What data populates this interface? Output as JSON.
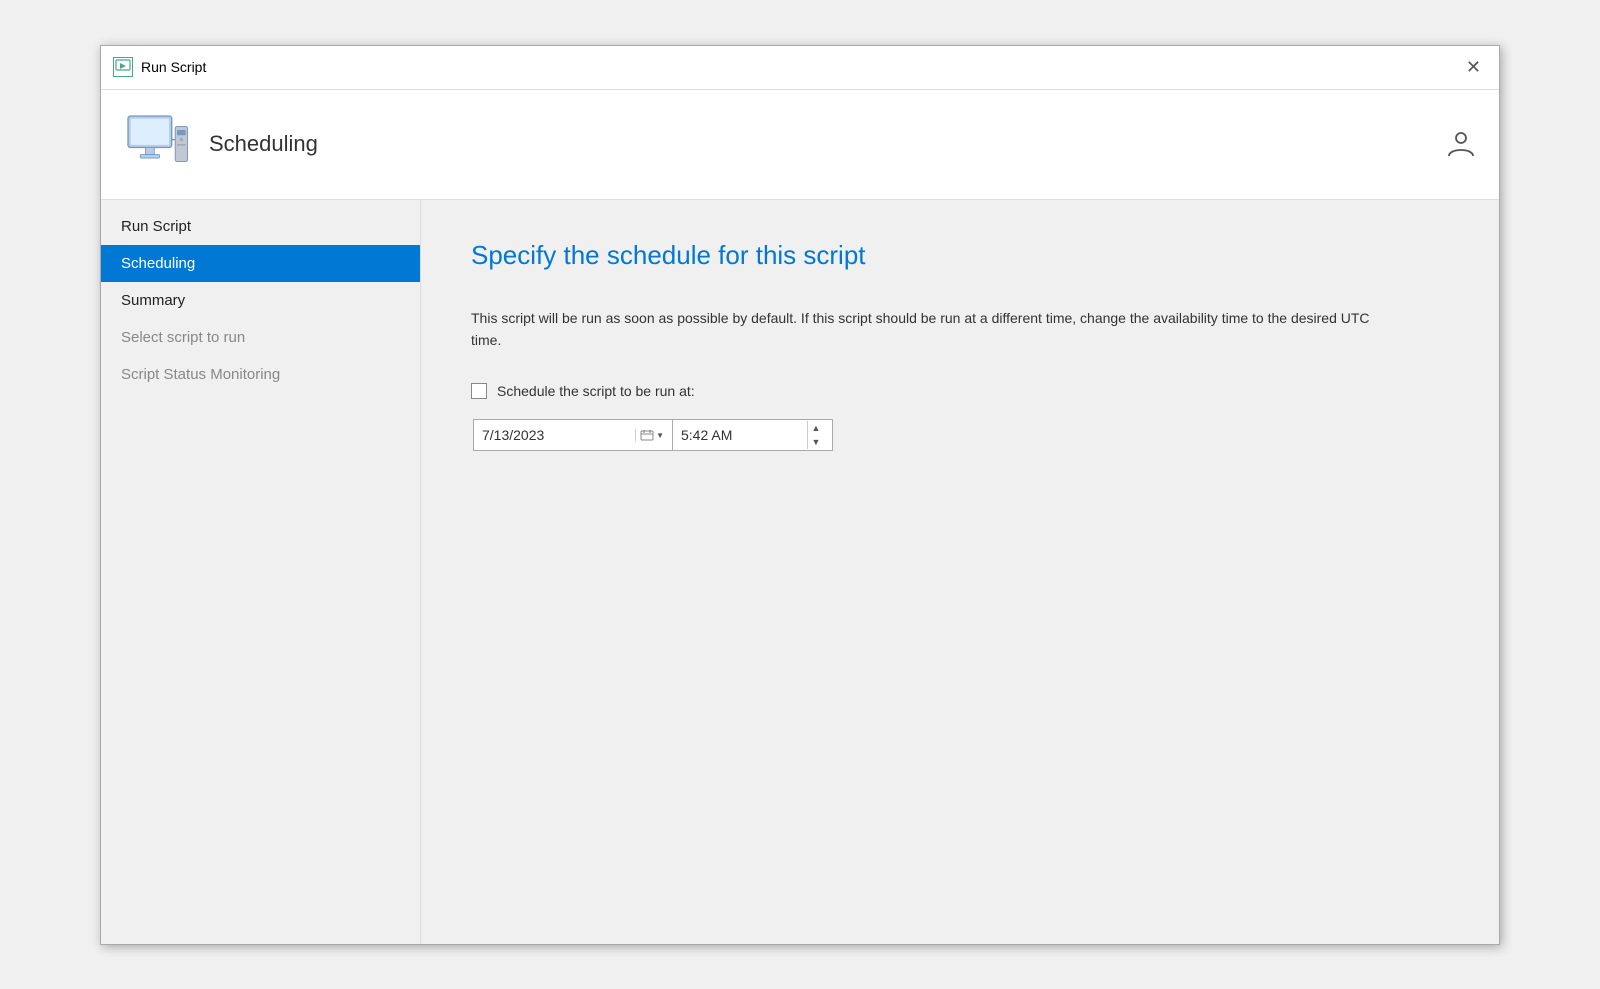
{
  "dialog": {
    "title": "Run Script",
    "close_label": "✕"
  },
  "header": {
    "title": "Scheduling",
    "help_icon": "?"
  },
  "sidebar": {
    "items": [
      {
        "id": "run-script",
        "label": "Run Script",
        "state": "normal"
      },
      {
        "id": "scheduling",
        "label": "Scheduling",
        "state": "active"
      },
      {
        "id": "summary",
        "label": "Summary",
        "state": "normal"
      },
      {
        "id": "select-script",
        "label": "Select script to run",
        "state": "disabled"
      },
      {
        "id": "script-status",
        "label": "Script Status Monitoring",
        "state": "disabled"
      }
    ]
  },
  "main": {
    "title": "Specify the schedule for this script",
    "description": "This script will be run as soon as possible by default. If this script should be run at a different time, change the availability time to the desired UTC time.",
    "schedule_checkbox_label": "Schedule the script to be run at:",
    "date_value": "7/13/2023",
    "time_value": "5:42 AM"
  }
}
